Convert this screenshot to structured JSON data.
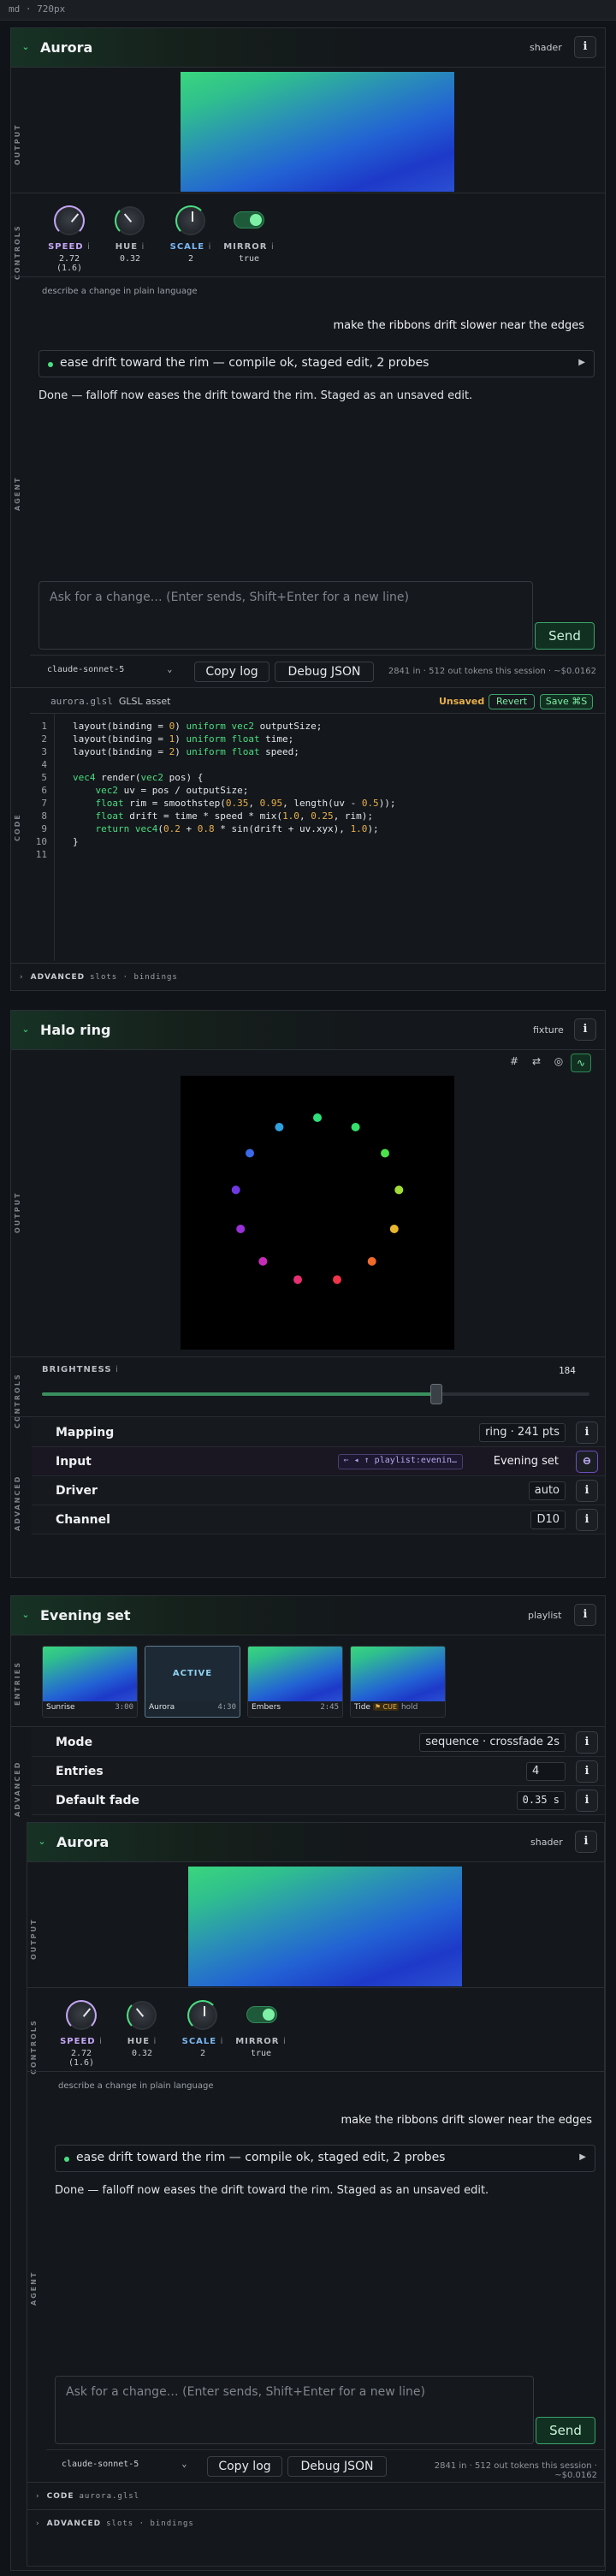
{
  "topbar": {
    "label": "md · 720px"
  },
  "aurora": {
    "title": "Aurora",
    "kind": "shader",
    "info": "i",
    "sections": {
      "output": "OUTPUT",
      "controls": "CONTROLS",
      "agent": "AGENT",
      "code": "CODE",
      "advanced": "ADVANCED"
    },
    "controls": [
      {
        "label": "SPEED",
        "info": "i",
        "value": "2.72 (1.6)",
        "color": "#c4a6f5"
      },
      {
        "label": "HUE",
        "info": "i",
        "value": "0.32",
        "color": "#9aa1a8"
      },
      {
        "label": "SCALE",
        "info": "i",
        "value": "2",
        "color": "#7ab8f5"
      },
      {
        "label": "MIRROR",
        "info": "i",
        "value": "true",
        "color": "#9aa1a8"
      }
    ],
    "agent": {
      "hint": "describe a change in plain language",
      "user_message": "make the ribbons drift slower near the edges",
      "step": "ease drift toward the rim — compile ok, staged edit, 2 probes",
      "step_arrow": "▶",
      "response": "Done — falloff now eases the drift toward the rim. Staged as an unsaved edit.",
      "input_placeholder": "Ask for a change… (Enter sends, Shift+Enter for a new line)",
      "send_label": "Send",
      "model": "claude-sonnet-5",
      "copy_log": "Copy log",
      "debug_json": "Debug JSON",
      "tokens": "2841 in · 512 out tokens this session · ~$0.0162"
    },
    "code": {
      "file": "aurora.glsl",
      "kind": "GLSL asset",
      "status": "Unsaved",
      "revert": "Revert",
      "save": "Save ⌘S",
      "line_numbers": [
        "1",
        "2",
        "3",
        "4",
        "5",
        "6",
        "7",
        "8",
        "9",
        "10",
        "11"
      ]
    },
    "advanced": {
      "label": "ADVANCED",
      "detail": "slots · bindings"
    }
  },
  "halo": {
    "title": "Halo ring",
    "kind": "fixture",
    "info": "i",
    "tools": [
      "#",
      "⇄",
      "◎",
      "∿"
    ],
    "sections": {
      "output": "OUTPUT",
      "controls": "CONTROLS",
      "advanced": "ADVANCED"
    },
    "brightness": {
      "label": "BRIGHTNESS",
      "info": "i",
      "value": "184",
      "level": 0.72
    },
    "rows": [
      {
        "label": "Mapping",
        "value": "ring · 241 pts",
        "info": "i"
      },
      {
        "label": "Input",
        "chip": "⇐ ◂ ↑ playlist:evenin…",
        "value": "Evening set",
        "info": "⊖"
      },
      {
        "label": "Driver",
        "value": "auto",
        "info": "i"
      },
      {
        "label": "Channel",
        "value": "D10",
        "info": "i"
      }
    ],
    "leds": [
      {
        "color": "#2ee07a"
      },
      {
        "color": "#34e06b"
      },
      {
        "color": "#4ce04a"
      },
      {
        "color": "#a0dd36"
      },
      {
        "color": "#e8b62c"
      },
      {
        "color": "#f06a2a"
      },
      {
        "color": "#f0344a"
      },
      {
        "color": "#e82f72"
      },
      {
        "color": "#c62cb8"
      },
      {
        "color": "#9a30d8"
      },
      {
        "color": "#7038e0"
      },
      {
        "color": "#3a6ae8"
      },
      {
        "color": "#2fa0e0"
      }
    ]
  },
  "playlist": {
    "title": "Evening set",
    "kind": "playlist",
    "info": "i",
    "sections": {
      "entries": "ENTRIES",
      "advanced": "ADVANCED"
    },
    "entries": [
      {
        "name": "Sunrise",
        "duration": "3:00"
      },
      {
        "name": "Aurora",
        "duration": "4:30",
        "badge": "ACTIVE"
      },
      {
        "name": "Embers",
        "duration": "2:45"
      },
      {
        "name": "Tide",
        "cue": "CUE",
        "hold": "hold"
      }
    ],
    "rows": [
      {
        "label": "Mode",
        "value": "sequence · crossfade 2s",
        "info": "i"
      },
      {
        "label": "Entries",
        "value": "4",
        "info": "i"
      },
      {
        "label": "Default fade",
        "value": "0.35 s",
        "info": "i"
      }
    ]
  },
  "aurora2": {
    "title": "Aurora",
    "kind": "shader",
    "info": "i",
    "code": {
      "label": "CODE",
      "file": "aurora.glsl"
    },
    "advanced": {
      "label": "ADVANCED",
      "detail": "slots · bindings"
    }
  }
}
